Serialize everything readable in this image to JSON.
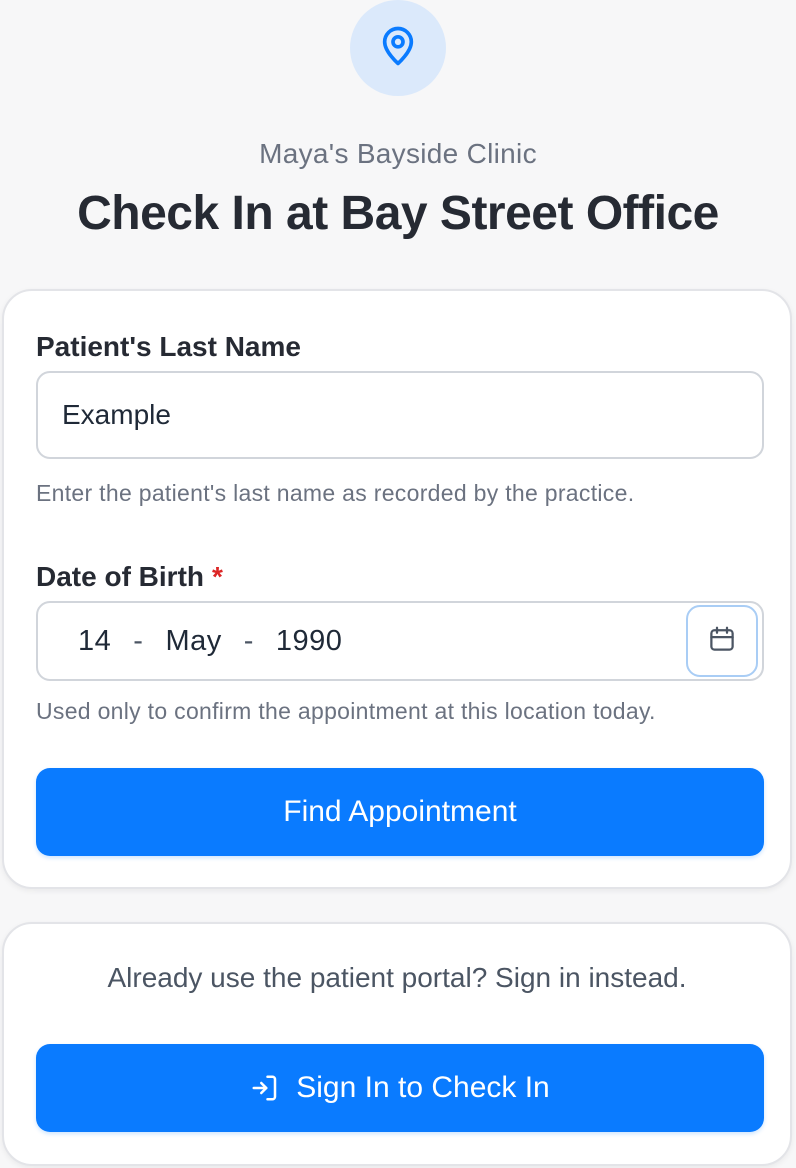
{
  "header": {
    "icon": "map-pin-icon",
    "clinic_name": "Maya's Bayside Clinic",
    "title": "Check In at Bay Street Office"
  },
  "form": {
    "last_name": {
      "label": "Patient's Last Name",
      "value": "Example",
      "helper": "Enter the patient's last name as recorded by the practice."
    },
    "dob": {
      "label": "Date of Birth",
      "required_marker": "*",
      "day": "14",
      "month": "May",
      "year": "1990",
      "separator": "-",
      "calendar_icon": "calendar-icon",
      "helper": "Used only to confirm the appointment at this location today."
    },
    "submit_label": "Find Appointment"
  },
  "portal": {
    "prompt": "Already use the patient portal? Sign in instead.",
    "button_label": "Sign In to Check In",
    "button_icon": "sign-in-icon"
  },
  "colors": {
    "accent": "#0a7bff",
    "badge_bg": "#dbe9fb",
    "required": "#dc2626"
  }
}
